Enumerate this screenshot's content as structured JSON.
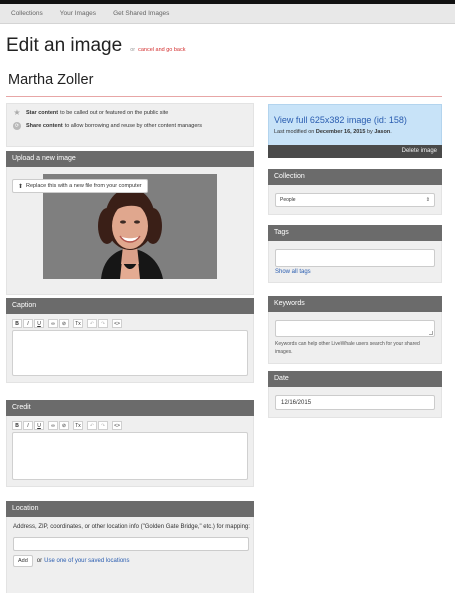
{
  "nav": {
    "items": [
      "Collections",
      "Your Images",
      "Get Shared Images"
    ]
  },
  "header": {
    "title": "Edit an image",
    "or_text": "or",
    "cancel_label": "cancel and go back"
  },
  "subject_name": "Martha Zoller",
  "status": {
    "star_bold": "Star content",
    "star_text": "to be called out or featured on the public site",
    "share_bold": "Share content",
    "share_text": "to allow borrowing and reuse by other content managers"
  },
  "upload": {
    "header": "Upload a new image",
    "replace_label": "Replace this with a new file from your computer"
  },
  "caption": {
    "header": "Caption"
  },
  "credit": {
    "header": "Credit"
  },
  "toolbar": {
    "bold": "B",
    "italic": "I",
    "underline": "U",
    "link": "🔗",
    "unlink": "⊘",
    "clear": "Tx",
    "undo": "↶",
    "redo": "↷",
    "source": "<>"
  },
  "location": {
    "header": "Location",
    "description": "Address, ZIP, coordinates, or other location info (\"Golden Gate Bridge,\" etc.) for mapping:",
    "add_label": "Add",
    "or_text": "or",
    "saved_link": "Use one of your saved locations"
  },
  "view": {
    "link": "View full 625x382 image (id: 158)",
    "modified_prefix": "Last modified on",
    "modified_date": "December 16, 2015",
    "modified_by": "by",
    "modified_user": "Jason",
    "delete_label": "Delete image"
  },
  "collection": {
    "header": "Collection",
    "selected": "People"
  },
  "tags": {
    "header": "Tags",
    "show_all": "Show all tags"
  },
  "keywords": {
    "header": "Keywords",
    "help": "Keywords can help other LiveWhale users search for your shared images."
  },
  "date": {
    "header": "Date",
    "value": "12/16/2015"
  },
  "colors": {
    "header_gray": "#6b6b6b",
    "link_blue": "#2a5db0",
    "cancel_red": "#d32f2f",
    "info_blue": "#c8e3f8"
  }
}
